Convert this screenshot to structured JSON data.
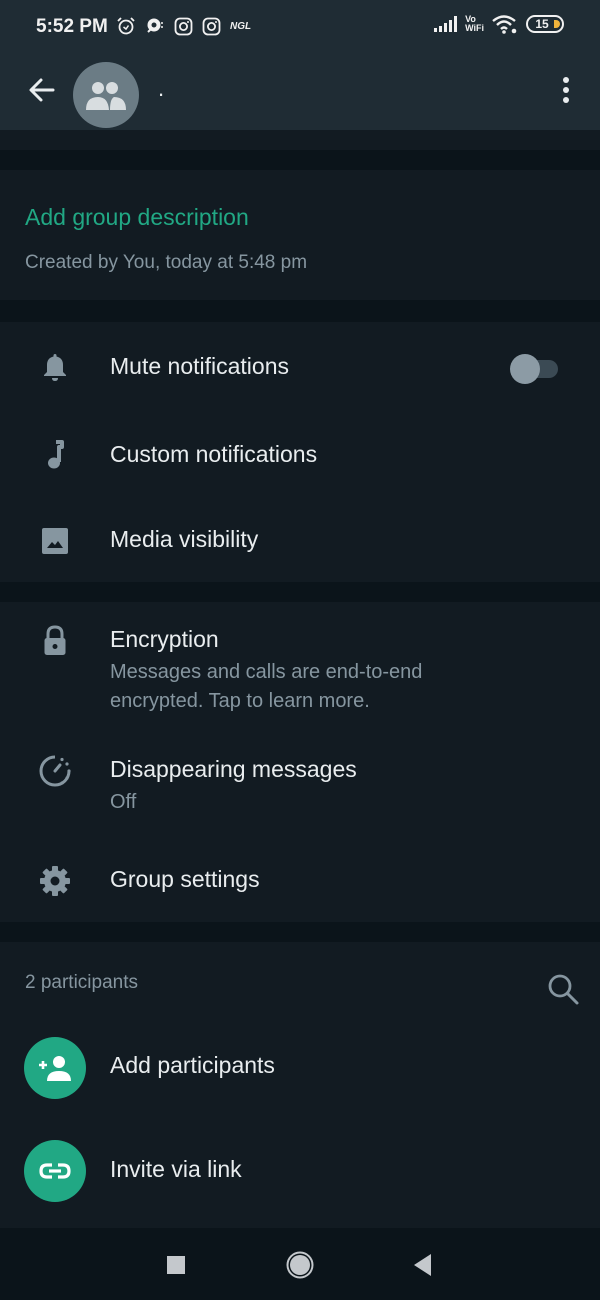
{
  "status_bar": {
    "time": "5:52 PM",
    "left_icons": [
      "alarm-icon",
      "chat-bubble-icon",
      "instagram-icon",
      "instagram-icon"
    ],
    "ngl_label": "NGL",
    "vowifi_top": "Vo",
    "vowifi_bottom": "WiFi",
    "battery_level": "15",
    "battery_charging_color": "#f0b43c"
  },
  "header": {
    "title": ".",
    "back_icon": "arrow-left-icon",
    "avatar_icon": "group-icon",
    "menu_icon": "more-vert-icon"
  },
  "description": {
    "add_link": "Add group description",
    "created": "Created by You, today at 5:48 pm"
  },
  "notifications_section": {
    "items": [
      {
        "label": "Mute notifications",
        "icon": "bell-icon",
        "toggle": false
      },
      {
        "label": "Custom notifications",
        "icon": "music-note-icon"
      },
      {
        "label": "Media visibility",
        "icon": "image-icon"
      }
    ]
  },
  "privacy_section": {
    "items": [
      {
        "label": "Encryption",
        "sub": "Messages and calls are end-to-end encrypted. Tap to learn more.",
        "sub_line1": "Messages and calls are end-to-end",
        "sub_line2": "encrypted. Tap to learn more.",
        "icon": "lock-icon"
      },
      {
        "label": "Disappearing messages",
        "sub": "Off",
        "icon": "timer-icon"
      },
      {
        "label": "Group settings",
        "icon": "gear-icon"
      }
    ]
  },
  "participants_section": {
    "count_label": "2 participants",
    "search_icon": "search-icon",
    "actions": [
      {
        "label": "Add participants",
        "icon": "add-person-icon"
      },
      {
        "label": "Invite via link",
        "icon": "link-icon"
      }
    ]
  },
  "colors": {
    "accent": "#21a884",
    "header_bg": "#1f2c34",
    "card_bg": "#121b22",
    "page_bg": "#0b141a",
    "secondary_text": "#8696a0"
  },
  "nav_bar": {
    "buttons": [
      "recents-square-icon",
      "home-circle-icon",
      "back-triangle-icon"
    ]
  }
}
